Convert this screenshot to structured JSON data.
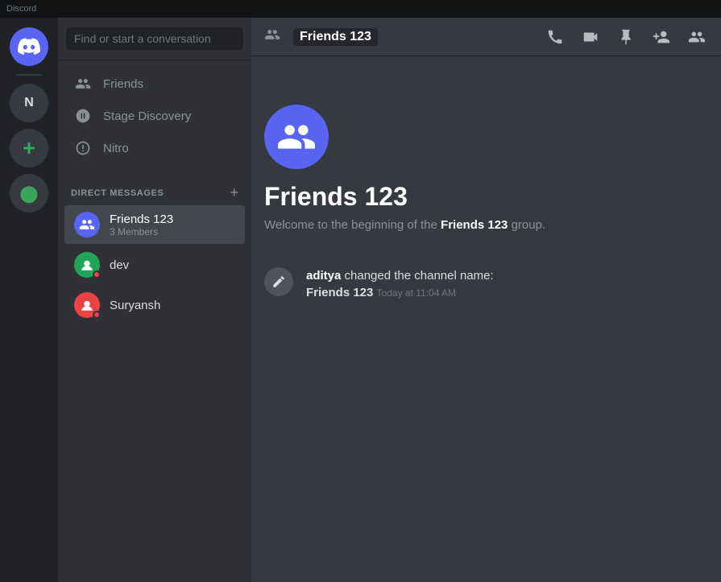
{
  "titlebar": {
    "label": "Discord"
  },
  "server_sidebar": {
    "discord_initial": "🎮",
    "user_initial": "N",
    "add_label": "+",
    "explore_label": "🧭"
  },
  "dm_sidebar": {
    "search_placeholder": "Find or start a conversation",
    "nav_items": [
      {
        "id": "friends",
        "label": "Friends",
        "icon": "👥"
      },
      {
        "id": "stage-discovery",
        "label": "Stage Discovery",
        "icon": "📡"
      },
      {
        "id": "nitro",
        "label": "Nitro",
        "icon": "🎯"
      }
    ],
    "direct_messages_header": "Direct Messages",
    "add_dm_label": "+",
    "dm_list": [
      {
        "id": "friends-123",
        "name": "Friends 123",
        "sub": "3 Members",
        "type": "group",
        "active": true
      },
      {
        "id": "dev",
        "name": "dev",
        "sub": "",
        "type": "dev",
        "active": false
      },
      {
        "id": "suryansh",
        "name": "Suryansh",
        "sub": "",
        "type": "suryansh",
        "active": false
      }
    ]
  },
  "topbar": {
    "group_name": "Friends 123",
    "icons": {
      "call": "📞",
      "video": "📹",
      "pin": "📌",
      "add_member": "👤+",
      "members": "👥"
    }
  },
  "chat": {
    "group_name": "Friends 123",
    "welcome_prefix": "Welcome to the beginning of the ",
    "group_name_bold": "Friends 123",
    "welcome_suffix": " group.",
    "event_user": "aditya",
    "event_text": " changed the channel name:",
    "event_channel": "Friends 123",
    "event_time": "Today at 11:04 AM"
  }
}
